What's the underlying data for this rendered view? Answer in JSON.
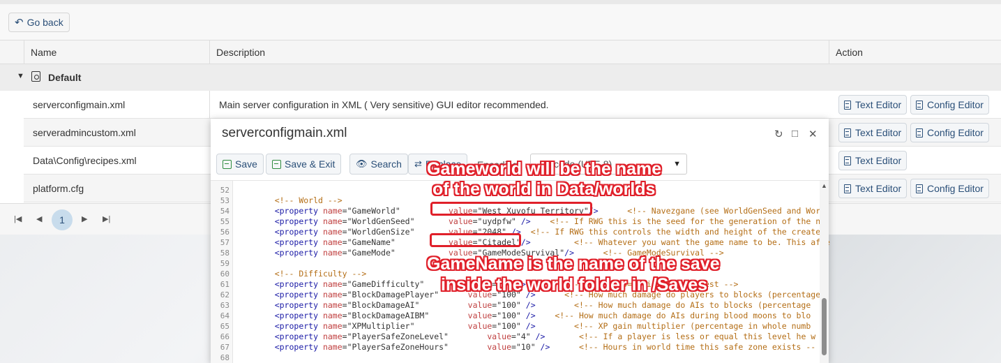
{
  "go_back": {
    "label": "Go back",
    "icon": "undo-arrow-icon"
  },
  "grid": {
    "headers": [
      "Name",
      "Description",
      "Action"
    ],
    "group_label": "Default",
    "rows": [
      {
        "name": "serverconfigmain.xml",
        "description": "Main server configuration in XML ( Very sensitive) GUI editor recommended.",
        "actions": [
          "Text Editor",
          "Config Editor"
        ]
      },
      {
        "name": "serveradmincustom.xml",
        "description": "",
        "actions": [
          "Text Editor",
          "Config Editor"
        ]
      },
      {
        "name": "Data\\Config\\recipes.xml",
        "description": "",
        "actions": [
          "Text Editor"
        ]
      },
      {
        "name": "platform.cfg",
        "description": "",
        "actions": [
          "Text Editor",
          "Config Editor"
        ]
      }
    ],
    "pager": {
      "current_page": "1"
    }
  },
  "dialog": {
    "title": "serverconfigmain.xml",
    "toolbar": {
      "save": "Save",
      "save_exit": "Save & Exit",
      "search": "Search",
      "replace": "Replace",
      "encoding_label": "Encoding",
      "encoding_value": "Unicode (UTF-8)"
    }
  },
  "editor": {
    "line_numbers": [
      "52",
      "53",
      "54",
      "55",
      "56",
      "57",
      "58",
      "59",
      "60",
      "61",
      "62",
      "63",
      "64",
      "65",
      "66",
      "67",
      "68"
    ],
    "lines": [
      "",
      "    <!-- World -->",
      "    <property name=\"GameWorld\"          value=\"West Xuyofu Territory\"/>      <!-- Navezgane (see WorldGenSeed and Worl",
      "    <property name=\"WorldGenSeed\"       value=\"uydpfw\" />    <!-- If RWG this is the seed for the generation of the ne",
      "    <property name=\"WorldGenSize\"       value=\"2048\" />  <!-- If RWG this controls the width and height of the created",
      "    <property name=\"GameName\"           value=\"Citadel\"/>         <!-- Whatever you want the game name to be. This affe",
      "    <property name=\"GameMode\"           value=\"GameModeSurvival\"/>      <!-- GameModeSurvival -->",
      "",
      "    <!-- Difficulty -->",
      "    <property name=\"GameDifficulty\"         value=\"2\" />        <!-- 0 - 5, 0=easiest, 5=hardest -->",
      "    <property name=\"BlockDamagePlayer\"      value=\"100\" />      <!-- How much damage do players to blocks (percentage",
      "    <property name=\"BlockDamageAI\"          value=\"100\" />        <!-- How much damage do AIs to blocks (percentage",
      "    <property name=\"BlockDamageAIBM\"        value=\"100\" />    <!-- How much damage do AIs during blood moons to blo",
      "    <property name=\"XPMultiplier\"           value=\"100\" />        <!-- XP gain multiplier (percentage in whole numb",
      "    <property name=\"PlayerSafeZoneLevel\"        value=\"4\" />       <!-- If a player is less or equal this level he w",
      "    <property name=\"PlayerSafeZoneHours\"        value=\"10\" />      <!-- Hours in world time this safe zone exists --",
      ""
    ]
  },
  "annotations": {
    "top_line1": "Gameworld will be the name",
    "top_line2": "of the world in Data/worlds",
    "bottom_line1": "GameName is the name of the save",
    "bottom_line2": "inside the world folder in /Saves",
    "color": "#e0202a"
  }
}
